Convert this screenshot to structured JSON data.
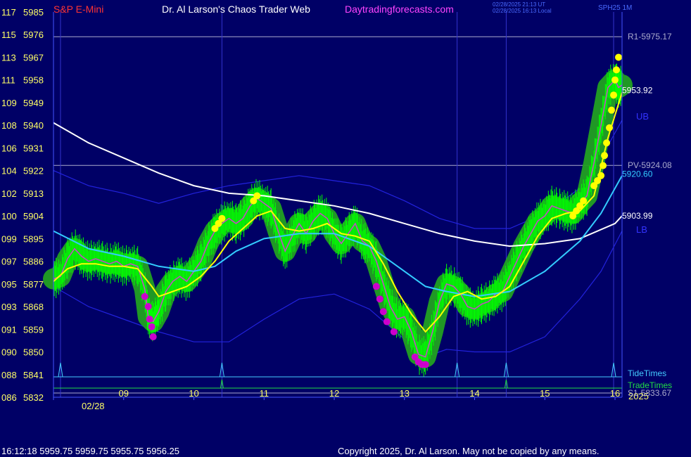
{
  "header": {
    "symbol": "S&P E-Mini",
    "title": "Dr. Al Larson's Chaos Trader Web",
    "site": "Daytradingforecasts.com",
    "timestamp_utc": "02/28/2025 21:13 UT",
    "timestamp_local": "02/28/2025 16:13 Local",
    "source": "SPH25 1M"
  },
  "footer": {
    "quote": "16:12:18  5959.75 5959.75 5955.75 5956.25",
    "copyright": "Copyright 2025, Dr. Al Larson. May not be copied by any means."
  },
  "colors": {
    "background": "#000066",
    "price": "#00ff00",
    "halo": "#22a022",
    "ema": "#ffff00",
    "avg_white": "#ffffff",
    "avg_cyan": "#33ccff",
    "band": "#2222dd",
    "tide": "#44ccff",
    "trade": "#22dd44",
    "level": "#aaaacc"
  },
  "chart_data": {
    "type": "line",
    "xlabel_date": "02/28",
    "x_end_label": "2025",
    "x_ticks": [
      "09",
      "10",
      "11",
      "12",
      "13",
      "14",
      "15",
      "16"
    ],
    "x_range": [
      8.0,
      16.1
    ],
    "y_range": [
      5832,
      5985
    ],
    "y_ticks": [
      {
        "left": "117",
        "price": "5985"
      },
      {
        "left": "115",
        "price": "5976"
      },
      {
        "left": "113",
        "price": "5967"
      },
      {
        "left": "111",
        "price": "5958"
      },
      {
        "left": "109",
        "price": "5949"
      },
      {
        "left": "108",
        "price": "5940"
      },
      {
        "left": "106",
        "price": "5931"
      },
      {
        "left": "104",
        "price": "5922"
      },
      {
        "left": "102",
        "price": "5913"
      },
      {
        "left": "100",
        "price": "5904"
      },
      {
        "left": "099",
        "price": "5895"
      },
      {
        "left": "097",
        "price": "5886"
      },
      {
        "left": "095",
        "price": "5877"
      },
      {
        "left": "093",
        "price": "5868"
      },
      {
        "left": "091",
        "price": "5859"
      },
      {
        "left": "090",
        "price": "5850"
      },
      {
        "left": "088",
        "price": "5841"
      },
      {
        "left": "086",
        "price": "5832"
      }
    ],
    "levels": [
      {
        "name": "R1",
        "label": "R1-5975.17",
        "value": 5975.17
      },
      {
        "name": "PV",
        "label": "PV-5924.08",
        "value": 5924.08
      },
      {
        "name": "S1",
        "label": "S1-5833.67",
        "value": 5833.67
      }
    ],
    "band_labels": {
      "upper": "UB",
      "lower": "LB"
    },
    "right_values": [
      {
        "label": "5953.92",
        "value": 5953.92,
        "series": "price"
      },
      {
        "label": "5920.60",
        "value": 5920.6,
        "series": "avg_cyan"
      },
      {
        "label": "5903.99",
        "value": 5903.99,
        "series": "avg_white"
      }
    ],
    "tide_label": "TideTimes",
    "trade_label": "TradeTimes",
    "tide_times": [
      8.1,
      10.4,
      13.75,
      14.45,
      15.98
    ],
    "trade_times": [
      10.4,
      14.45
    ],
    "vertical_markers": [
      8.1,
      10.4,
      13.75,
      14.45,
      15.98
    ],
    "series": [
      {
        "key": "price",
        "points": [
          [
            8.0,
            5879
          ],
          [
            8.1,
            5880
          ],
          [
            8.2,
            5887
          ],
          [
            8.3,
            5891
          ],
          [
            8.4,
            5888
          ],
          [
            8.5,
            5886
          ],
          [
            8.6,
            5887
          ],
          [
            8.7,
            5886
          ],
          [
            8.8,
            5885
          ],
          [
            8.9,
            5886
          ],
          [
            9.0,
            5884
          ],
          [
            9.1,
            5885
          ],
          [
            9.2,
            5884
          ],
          [
            9.3,
            5875
          ],
          [
            9.35,
            5864
          ],
          [
            9.42,
            5862
          ],
          [
            9.5,
            5866
          ],
          [
            9.6,
            5874
          ],
          [
            9.7,
            5878
          ],
          [
            9.8,
            5880
          ],
          [
            9.9,
            5878
          ],
          [
            10.0,
            5882
          ],
          [
            10.1,
            5886
          ],
          [
            10.2,
            5893
          ],
          [
            10.3,
            5898
          ],
          [
            10.4,
            5901
          ],
          [
            10.5,
            5903
          ],
          [
            10.6,
            5901
          ],
          [
            10.7,
            5903
          ],
          [
            10.8,
            5908
          ],
          [
            10.9,
            5911
          ],
          [
            11.0,
            5909
          ],
          [
            11.1,
            5907
          ],
          [
            11.2,
            5898
          ],
          [
            11.3,
            5890
          ],
          [
            11.4,
            5896
          ],
          [
            11.5,
            5901
          ],
          [
            11.6,
            5897
          ],
          [
            11.7,
            5902
          ],
          [
            11.8,
            5905
          ],
          [
            11.9,
            5903
          ],
          [
            12.0,
            5897
          ],
          [
            12.1,
            5893
          ],
          [
            12.2,
            5897
          ],
          [
            12.3,
            5901
          ],
          [
            12.4,
            5894
          ],
          [
            12.5,
            5892
          ],
          [
            12.6,
            5886
          ],
          [
            12.7,
            5877
          ],
          [
            12.8,
            5868
          ],
          [
            12.9,
            5863
          ],
          [
            13.0,
            5864
          ],
          [
            13.1,
            5858
          ],
          [
            13.2,
            5849
          ],
          [
            13.3,
            5848
          ],
          [
            13.4,
            5858
          ],
          [
            13.5,
            5870
          ],
          [
            13.6,
            5877
          ],
          [
            13.7,
            5876
          ],
          [
            13.8,
            5873
          ],
          [
            13.9,
            5868
          ],
          [
            14.0,
            5867
          ],
          [
            14.1,
            5869
          ],
          [
            14.2,
            5870
          ],
          [
            14.3,
            5873
          ],
          [
            14.4,
            5874
          ],
          [
            14.5,
            5880
          ],
          [
            14.6,
            5886
          ],
          [
            14.7,
            5892
          ],
          [
            14.8,
            5897
          ],
          [
            14.9,
            5902
          ],
          [
            15.0,
            5904
          ],
          [
            15.1,
            5908
          ],
          [
            15.2,
            5907
          ],
          [
            15.3,
            5906
          ],
          [
            15.4,
            5905
          ],
          [
            15.5,
            5909
          ],
          [
            15.6,
            5912
          ],
          [
            15.7,
            5925
          ],
          [
            15.8,
            5940
          ],
          [
            15.9,
            5955
          ],
          [
            16.0,
            5958
          ],
          [
            16.05,
            5955
          ],
          [
            16.1,
            5956
          ]
        ]
      },
      {
        "key": "ema",
        "points": [
          [
            8.0,
            5878
          ],
          [
            8.2,
            5883
          ],
          [
            8.4,
            5885
          ],
          [
            8.6,
            5885
          ],
          [
            8.8,
            5884
          ],
          [
            9.0,
            5884
          ],
          [
            9.2,
            5883
          ],
          [
            9.4,
            5876
          ],
          [
            9.5,
            5872
          ],
          [
            9.7,
            5874
          ],
          [
            9.9,
            5876
          ],
          [
            10.1,
            5880
          ],
          [
            10.3,
            5886
          ],
          [
            10.5,
            5894
          ],
          [
            10.7,
            5899
          ],
          [
            10.9,
            5904
          ],
          [
            11.1,
            5906
          ],
          [
            11.3,
            5899
          ],
          [
            11.5,
            5898
          ],
          [
            11.7,
            5899
          ],
          [
            11.9,
            5901
          ],
          [
            12.1,
            5897
          ],
          [
            12.3,
            5896
          ],
          [
            12.5,
            5894
          ],
          [
            12.7,
            5885
          ],
          [
            12.9,
            5874
          ],
          [
            13.1,
            5865
          ],
          [
            13.3,
            5858
          ],
          [
            13.5,
            5864
          ],
          [
            13.7,
            5872
          ],
          [
            13.9,
            5874
          ],
          [
            14.1,
            5871
          ],
          [
            14.3,
            5872
          ],
          [
            14.5,
            5876
          ],
          [
            14.7,
            5886
          ],
          [
            14.9,
            5896
          ],
          [
            15.1,
            5903
          ],
          [
            15.3,
            5905
          ],
          [
            15.5,
            5906
          ],
          [
            15.7,
            5912
          ],
          [
            15.9,
            5935
          ],
          [
            16.1,
            5953
          ]
        ]
      },
      {
        "key": "avg_white",
        "points": [
          [
            8.0,
            5941
          ],
          [
            8.5,
            5933
          ],
          [
            9.0,
            5927
          ],
          [
            9.5,
            5921
          ],
          [
            10.0,
            5916
          ],
          [
            10.5,
            5913
          ],
          [
            11.0,
            5912
          ],
          [
            11.5,
            5910
          ],
          [
            12.0,
            5908
          ],
          [
            12.5,
            5905
          ],
          [
            13.0,
            5901
          ],
          [
            13.5,
            5897
          ],
          [
            14.0,
            5894
          ],
          [
            14.5,
            5892
          ],
          [
            15.0,
            5893
          ],
          [
            15.5,
            5895
          ],
          [
            16.0,
            5901
          ],
          [
            16.1,
            5904
          ]
        ]
      },
      {
        "key": "avg_cyan",
        "points": [
          [
            8.0,
            5898
          ],
          [
            8.5,
            5891
          ],
          [
            9.0,
            5888
          ],
          [
            9.5,
            5884
          ],
          [
            10.0,
            5882
          ],
          [
            10.3,
            5884
          ],
          [
            10.6,
            5890
          ],
          [
            11.0,
            5895
          ],
          [
            11.5,
            5897
          ],
          [
            12.0,
            5897
          ],
          [
            12.5,
            5892
          ],
          [
            13.0,
            5882
          ],
          [
            13.3,
            5876
          ],
          [
            13.6,
            5874
          ],
          [
            14.0,
            5872
          ],
          [
            14.5,
            5874
          ],
          [
            15.0,
            5882
          ],
          [
            15.5,
            5894
          ],
          [
            15.8,
            5905
          ],
          [
            16.1,
            5920
          ]
        ]
      },
      {
        "key": "band_upper",
        "points": [
          [
            8.0,
            5922
          ],
          [
            8.5,
            5916
          ],
          [
            9.0,
            5913
          ],
          [
            9.5,
            5909
          ],
          [
            10.0,
            5913
          ],
          [
            10.5,
            5916
          ],
          [
            11.0,
            5918
          ],
          [
            11.5,
            5920
          ],
          [
            12.0,
            5918
          ],
          [
            12.5,
            5916
          ],
          [
            13.0,
            5910
          ],
          [
            13.5,
            5903
          ],
          [
            14.0,
            5899
          ],
          [
            14.5,
            5899
          ],
          [
            15.0,
            5905
          ],
          [
            15.5,
            5915
          ],
          [
            15.8,
            5927
          ],
          [
            16.1,
            5942
          ]
        ]
      },
      {
        "key": "band_lower",
        "points": [
          [
            8.0,
            5876
          ],
          [
            8.5,
            5868
          ],
          [
            9.0,
            5863
          ],
          [
            9.5,
            5858
          ],
          [
            10.0,
            5854
          ],
          [
            10.5,
            5854
          ],
          [
            11.0,
            5863
          ],
          [
            11.5,
            5871
          ],
          [
            12.0,
            5873
          ],
          [
            12.5,
            5867
          ],
          [
            13.0,
            5855
          ],
          [
            13.3,
            5848
          ],
          [
            13.6,
            5851
          ],
          [
            14.0,
            5850
          ],
          [
            14.5,
            5850
          ],
          [
            15.0,
            5856
          ],
          [
            15.5,
            5871
          ],
          [
            15.8,
            5882
          ],
          [
            16.1,
            5898
          ]
        ]
      }
    ],
    "yellow_dots": [
      [
        10.3,
        5899
      ],
      [
        10.35,
        5901
      ],
      [
        10.4,
        5903
      ],
      [
        10.85,
        5910
      ],
      [
        10.9,
        5912
      ],
      [
        15.4,
        5904
      ],
      [
        15.45,
        5906
      ],
      [
        15.5,
        5908
      ],
      [
        15.55,
        5910
      ],
      [
        15.7,
        5916
      ],
      [
        15.75,
        5918
      ],
      [
        15.8,
        5920
      ],
      [
        15.83,
        5924
      ],
      [
        15.85,
        5928
      ],
      [
        15.88,
        5933
      ],
      [
        15.92,
        5939
      ],
      [
        15.95,
        5946
      ],
      [
        15.98,
        5952
      ],
      [
        16.0,
        5958
      ],
      [
        16.02,
        5962
      ],
      [
        16.05,
        5967
      ]
    ],
    "magenta_dots": [
      [
        9.3,
        5872
      ],
      [
        9.35,
        5868
      ],
      [
        9.37,
        5863
      ],
      [
        9.4,
        5860
      ],
      [
        9.42,
        5856
      ],
      [
        12.6,
        5876
      ],
      [
        12.65,
        5871
      ],
      [
        12.7,
        5866
      ],
      [
        12.75,
        5862
      ],
      [
        12.85,
        5858
      ],
      [
        13.15,
        5848
      ],
      [
        13.2,
        5846
      ],
      [
        13.25,
        5845
      ],
      [
        13.3,
        5845
      ]
    ]
  }
}
